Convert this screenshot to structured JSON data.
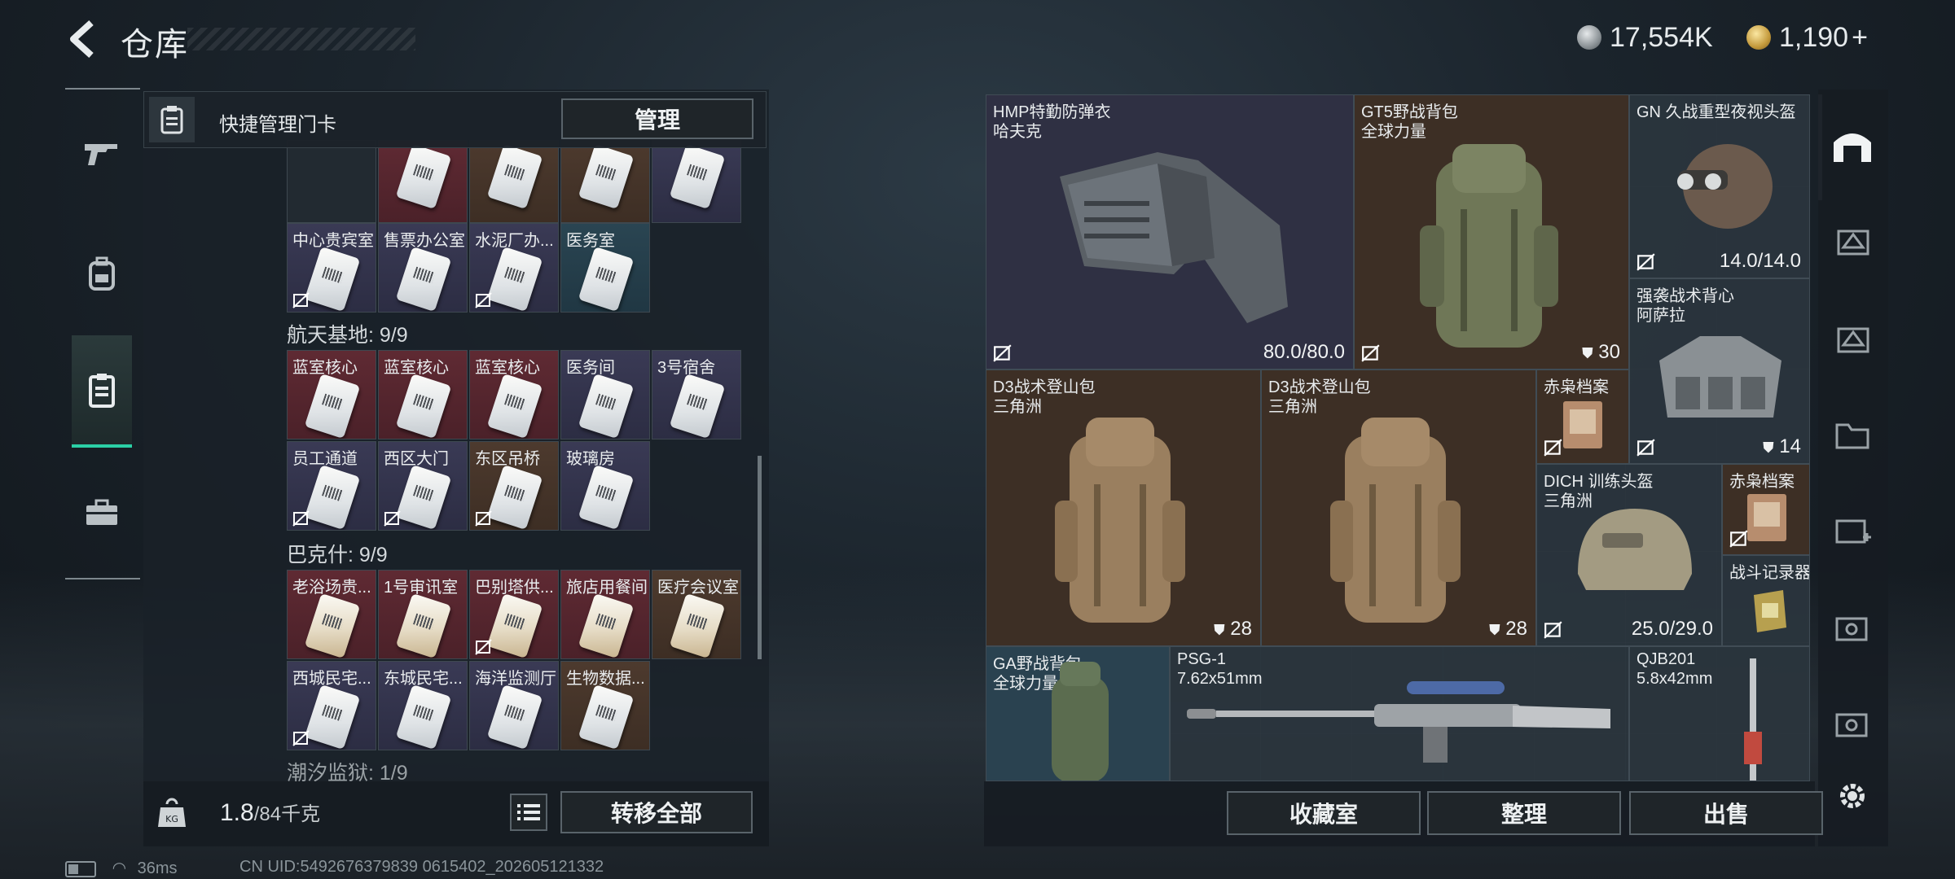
{
  "header": {
    "title": "仓库",
    "currency1": "17,554K",
    "currency2": "1,190",
    "add_label": "+"
  },
  "quick_manage": {
    "label": "快捷管理门卡",
    "button": "管理"
  },
  "sections": [
    {
      "title": "航天基地: 9/9"
    },
    {
      "title": "巴克什: 9/9"
    },
    {
      "title": "潮汐监狱: 1/9"
    }
  ],
  "cards_top": [
    "",
    "",
    "",
    "",
    ""
  ],
  "cards_row2": [
    "中心贵宾室",
    "售票办公室",
    "水泥厂办...",
    "医务室"
  ],
  "cards_space1": [
    "蓝室核心",
    "蓝室核心",
    "蓝室核心",
    "医务间",
    "3号宿舍"
  ],
  "cards_space2": [
    "员工通道",
    "西区大门",
    "东区吊桥",
    "玻璃房"
  ],
  "cards_baks1": [
    "老浴场贵...",
    "1号审讯室",
    "巴别塔供...",
    "旅店用餐间",
    "医疗会议室"
  ],
  "cards_baks2": [
    "西城民宅...",
    "东城民宅...",
    "海洋监测厅",
    "生物数据..."
  ],
  "weight": {
    "value": "1.8",
    "max": "/84千克"
  },
  "transfer_all": "转移全部",
  "items": {
    "armor": {
      "name": "HMP特勤防弹衣",
      "brand": "哈夫克",
      "value": "80.0/80.0"
    },
    "gt5": {
      "name": "GT5野战背包",
      "brand": "全球力量",
      "value": "30"
    },
    "nvg": {
      "name": "GN 久战重型夜视头盔",
      "value": "14.0/14.0"
    },
    "vest": {
      "name": "强袭战术背心",
      "brand": "阿萨拉",
      "value": "14"
    },
    "d3a": {
      "name": "D3战术登山包",
      "brand": "三角洲",
      "value": "28"
    },
    "d3b": {
      "name": "D3战术登山包",
      "brand": "三角洲",
      "value": "28"
    },
    "file1": {
      "name": "赤枭档案"
    },
    "helmet": {
      "name": "DICH 训练头盔",
      "brand": "三角洲",
      "value": "25.0/29.0"
    },
    "file2": {
      "name": "赤枭档案"
    },
    "recorder": {
      "name": "战斗记录器"
    },
    "ga": {
      "name": "GA野战背包",
      "brand": "全球力量"
    },
    "psg": {
      "name": "PSG-1",
      "brand": "7.62x51mm"
    },
    "qjb": {
      "name": "QJB201",
      "brand": "5.8x42mm"
    }
  },
  "bottom_buttons": {
    "collection": "收藏室",
    "sort": "整理",
    "sell": "出售"
  },
  "status": {
    "ping": "36ms",
    "uid": "CN UID:5492676379839 0615402_202605121332"
  },
  "colors": {
    "accent": "#2bd0a6",
    "red_card": "#5f2a33",
    "brown_card": "#4d3a2e",
    "purple_card": "#3a3a55"
  }
}
